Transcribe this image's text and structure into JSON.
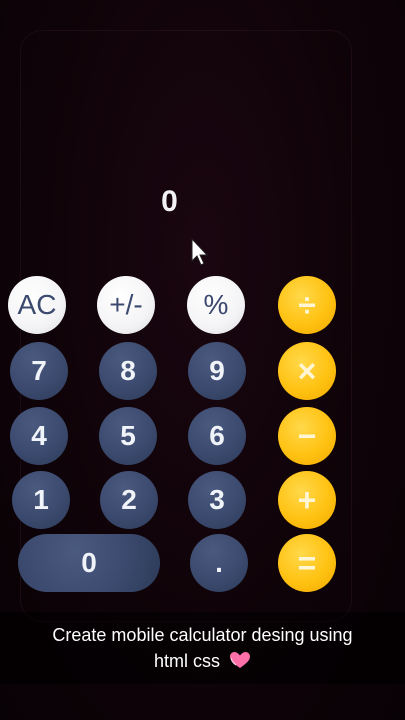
{
  "display": {
    "value": "0"
  },
  "keys": {
    "ac": "AC",
    "sign": "+/-",
    "percent": "%",
    "divide": "÷",
    "seven": "7",
    "eight": "8",
    "nine": "9",
    "multiply": "×",
    "four": "4",
    "five": "5",
    "six": "6",
    "minus": "−",
    "one": "1",
    "two": "2",
    "three": "3",
    "plus": "+",
    "zero": "0",
    "decimal": ".",
    "equals": "="
  },
  "caption": {
    "line1": "Create mobile calculator desing using",
    "line2": "html css"
  },
  "icons": {
    "caption_emoji": "heart-icon",
    "pointer": "mouse-cursor-icon"
  },
  "colors": {
    "function_key": "#f4f4f6",
    "number_key": "#3b4a6e",
    "operator_key": "#ffc212",
    "background": "#0e0308"
  }
}
